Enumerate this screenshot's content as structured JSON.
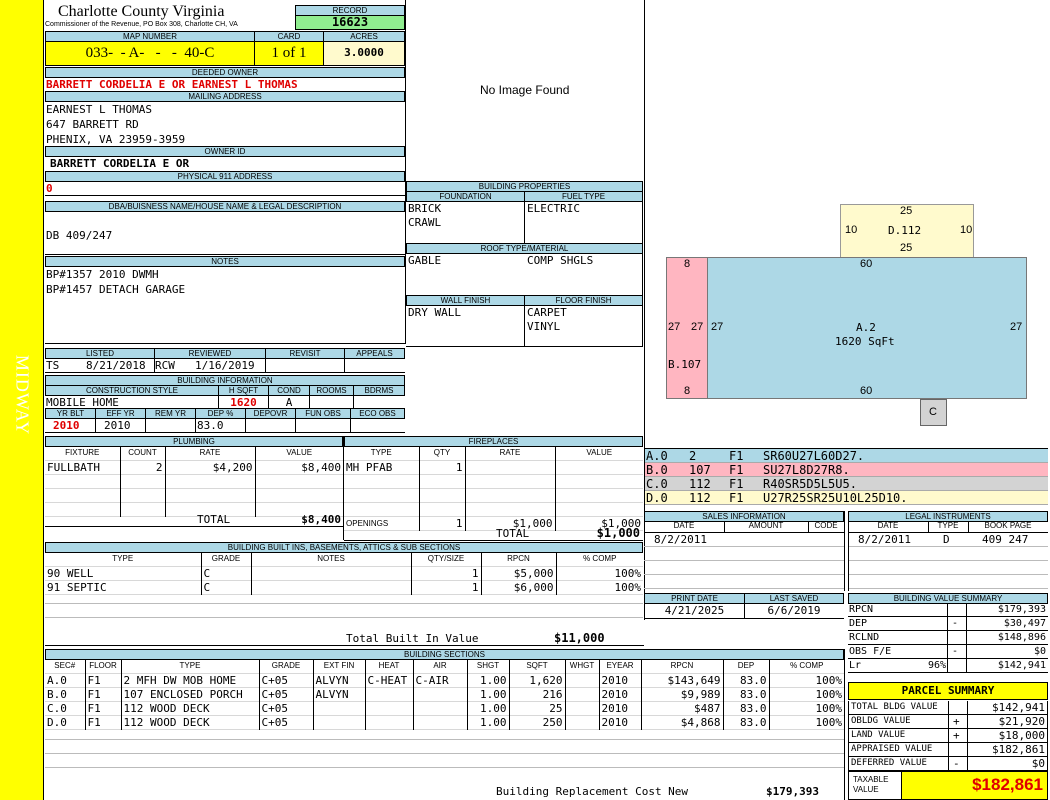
{
  "side_label": "MIDWAY",
  "header": {
    "county": "Charlotte County Virginia",
    "commissioner": "Commissioner of the Revenue, PO Box 308, Charlotte CH, VA",
    "record_label": "RECORD",
    "record": "16623",
    "map_number_label": "MAP NUMBER",
    "map_number": "033-  - A-   -   -  40-C",
    "card_label": "CARD",
    "card": "1 of 1",
    "acres_label": "ACRES",
    "acres": "3.0000"
  },
  "owner": {
    "deeded_label": "DEEDED OWNER",
    "deeded_owner": "BARRETT CORDELIA E OR EARNEST L THOMAS",
    "mailing_label": "MAILING ADDRESS",
    "mailing": [
      "EARNEST L THOMAS",
      "647 BARRETT RD",
      "PHENIX, VA 23959-3959"
    ],
    "owner_id_label": "OWNER ID",
    "owner_id": "BARRETT CORDELIA E OR",
    "physical_label": "PHYSICAL 911 ADDRESS",
    "physical": "0"
  },
  "legal": {
    "label": "DBA/BUISNESS NAME/HOUSE NAME & LEGAL DESCRIPTION",
    "text": "DB 409/247"
  },
  "notes": {
    "label": "NOTES",
    "lines": [
      "BP#1357 2010 DWMH",
      "BP#1457 DETACH GARAGE"
    ]
  },
  "image": {
    "no_image": "No Image Found"
  },
  "listing": {
    "listed_label": "LISTED",
    "listed_by": "TS",
    "listed_date": "8/21/2018",
    "reviewed_label": "REVIEWED",
    "reviewed_by": "RCW",
    "reviewed_date": "1/16/2019",
    "revisit_label": "REVISIT",
    "appeals_label": "APPEALS"
  },
  "building_info": {
    "label": "BUILDING INFORMATION",
    "construction_label": "CONSTRUCTION STYLE",
    "construction": "MOBILE HOME",
    "hsqft_label": "H SQFT",
    "hsqft": "1620",
    "cond_label": "COND",
    "cond": "A",
    "rooms_label": "ROOMS",
    "bdrms_label": "BDRMS",
    "yrblt_label": "YR BLT",
    "yrblt": "2010",
    "effyr_label": "EFF YR",
    "effyr": "2010",
    "remyr_label": "REM YR",
    "dep_label": "DEP %",
    "dep": "83.0",
    "depovr_label": "DEPOVR",
    "funobs_label": "FUN OBS",
    "ecoobs_label": "ECO OBS"
  },
  "building_props": {
    "label": "BUILDING PROPERTIES",
    "foundation_label": "FOUNDATION",
    "foundation": [
      "BRICK",
      "CRAWL"
    ],
    "fuel_label": "FUEL TYPE",
    "fuel": "ELECTRIC",
    "roof_label": "ROOF TYPE/MATERIAL",
    "roof_type": "GABLE",
    "roof_material": "COMP SHGLS",
    "wall_label": "WALL FINISH",
    "wall": "DRY WALL",
    "floor_label": "FLOOR FINISH",
    "floor": [
      "CARPET",
      "VINYL"
    ]
  },
  "sketch": {
    "d_top": "25",
    "d_left": "10",
    "d_right": "10",
    "d_label": "D.112",
    "d_bottom": "25",
    "a_top": "60",
    "a_left": "27",
    "a_right": "27",
    "a_label": "A.2",
    "a_sqft": "1620 SqFt",
    "a_bottom": "60",
    "b_top": "8",
    "b_left": "27",
    "b_right": "27",
    "b_label": "B.107",
    "b_bottom": "8",
    "c_label": "C"
  },
  "sketch_legend": [
    {
      "code": "A.0",
      "num": "2",
      "fl": "F1",
      "vec": "SR60U27L60D27.",
      "color": "#add8e6"
    },
    {
      "code": "B.0",
      "num": "107",
      "fl": "F1",
      "vec": "SU27L8D27R8.",
      "color": "#ffb6c1"
    },
    {
      "code": "C.0",
      "num": "112",
      "fl": "F1",
      "vec": "R40SR5D5L5U5.",
      "color": "#d3d3d3"
    },
    {
      "code": "D.0",
      "num": "112",
      "fl": "F1",
      "vec": "U27R25SR25U10L25D10.",
      "color": "#fffacd"
    }
  ],
  "plumbing": {
    "label": "PLUMBING",
    "headers": [
      "FIXTURE",
      "COUNT",
      "RATE",
      "VALUE"
    ],
    "rows": [
      [
        "FULLBATH",
        "2",
        "$4,200",
        "$8,400"
      ]
    ],
    "total_label": "TOTAL",
    "total": "$8,400"
  },
  "fireplaces": {
    "label": "FIREPLACES",
    "headers": [
      "TYPE",
      "QTY",
      "RATE",
      "VALUE"
    ],
    "rows": [
      [
        "MH PFAB",
        "1",
        "",
        ""
      ]
    ],
    "openings_label": "OPENINGS",
    "openings_qty": "1",
    "openings_rate": "$1,000",
    "openings_value": "$1,000",
    "total_label": "TOTAL",
    "total": "$1,000"
  },
  "built_ins": {
    "label": "BUILDING BUILT INS, BASEMENTS, ATTICS & SUB SECTIONS",
    "headers": [
      "TYPE",
      "GRADE",
      "NOTES",
      "QTY/SIZE",
      "RPCN",
      "% COMP"
    ],
    "rows": [
      [
        "90 WELL",
        "C",
        "",
        "1",
        "$5,000",
        "100%"
      ],
      [
        "91 SEPTIC",
        "C",
        "",
        "1",
        "$6,000",
        "100%"
      ]
    ],
    "total_label": "Total Built In Value",
    "total": "$11,000"
  },
  "sales": {
    "label": "SALES INFORMATION",
    "headers": [
      "DATE",
      "AMOUNT",
      "CODE"
    ],
    "rows": [
      [
        "8/2/2011",
        "",
        ""
      ]
    ]
  },
  "legal_instruments": {
    "label": "LEGAL INSTRUMENTS",
    "headers": [
      "DATE",
      "TYPE",
      "BOOK PAGE"
    ],
    "rows": [
      [
        "8/2/2011",
        "D",
        "409 247"
      ]
    ]
  },
  "print_info": {
    "print_label": "PRINT DATE",
    "print_date": "4/21/2025",
    "saved_label": "LAST SAVED",
    "saved_date": "6/6/2019"
  },
  "value_summary": {
    "label": "BUILDING VALUE SUMMARY",
    "rows": [
      {
        "label": "RPCN",
        "sign": "",
        "pct": "",
        "value": "$179,393"
      },
      {
        "label": "DEP",
        "sign": "-",
        "pct": "",
        "value": "$30,497"
      },
      {
        "label": "RCLND",
        "sign": "",
        "pct": "",
        "value": "$148,896"
      },
      {
        "label": "OBS F/E",
        "sign": "-",
        "pct": "",
        "value": "$0"
      },
      {
        "label": "Lr",
        "sign": "",
        "pct": "96%",
        "value": "$142,941"
      }
    ]
  },
  "parcel_summary": {
    "label": "PARCEL SUMMARY",
    "rows": [
      {
        "label": "TOTAL BLDG VALUE",
        "sign": "",
        "value": "$142,941"
      },
      {
        "label": "OBLDG VALUE",
        "sign": "+",
        "value": "$21,920"
      },
      {
        "label": "LAND VALUE",
        "sign": "+",
        "value": "$18,000"
      },
      {
        "label": "APPRAISED VALUE",
        "sign": "",
        "value": "$182,861"
      },
      {
        "label": "DEFERRED VALUE",
        "sign": "-",
        "value": "$0"
      }
    ],
    "taxable_label": "TAXABLE VALUE",
    "taxable": "$182,861"
  },
  "sections": {
    "label": "BUILDING SECTIONS",
    "headers": [
      "SEC#",
      "FLOOR",
      "TYPE",
      "GRADE",
      "EXT FIN",
      "HEAT",
      "AIR",
      "SHGT",
      "SQFT",
      "WHGT",
      "EYEAR",
      "RPCN",
      "DEP",
      "% COMP"
    ],
    "rows": [
      [
        "A.0",
        "F1",
        "2 MFH DW MOB HOME",
        "C+05",
        "ALVYN",
        "C-HEAT",
        "C-AIR",
        "1.00",
        "1,620",
        "",
        "2010",
        "$143,649",
        "83.0",
        "100%"
      ],
      [
        "B.0",
        "F1",
        "107 ENCLOSED PORCH",
        "C+05",
        "ALVYN",
        "",
        "",
        "1.00",
        "216",
        "",
        "2010",
        "$9,989",
        "83.0",
        "100%"
      ],
      [
        "C.0",
        "F1",
        "112 WOOD DECK",
        "C+05",
        "",
        "",
        "",
        "1.00",
        "25",
        "",
        "2010",
        "$487",
        "83.0",
        "100%"
      ],
      [
        "D.0",
        "F1",
        "112 WOOD DECK",
        "C+05",
        "",
        "",
        "",
        "1.00",
        "250",
        "",
        "2010",
        "$4,868",
        "83.0",
        "100%"
      ]
    ],
    "total_label": "Building Replacement Cost New",
    "total": "$179,393"
  }
}
